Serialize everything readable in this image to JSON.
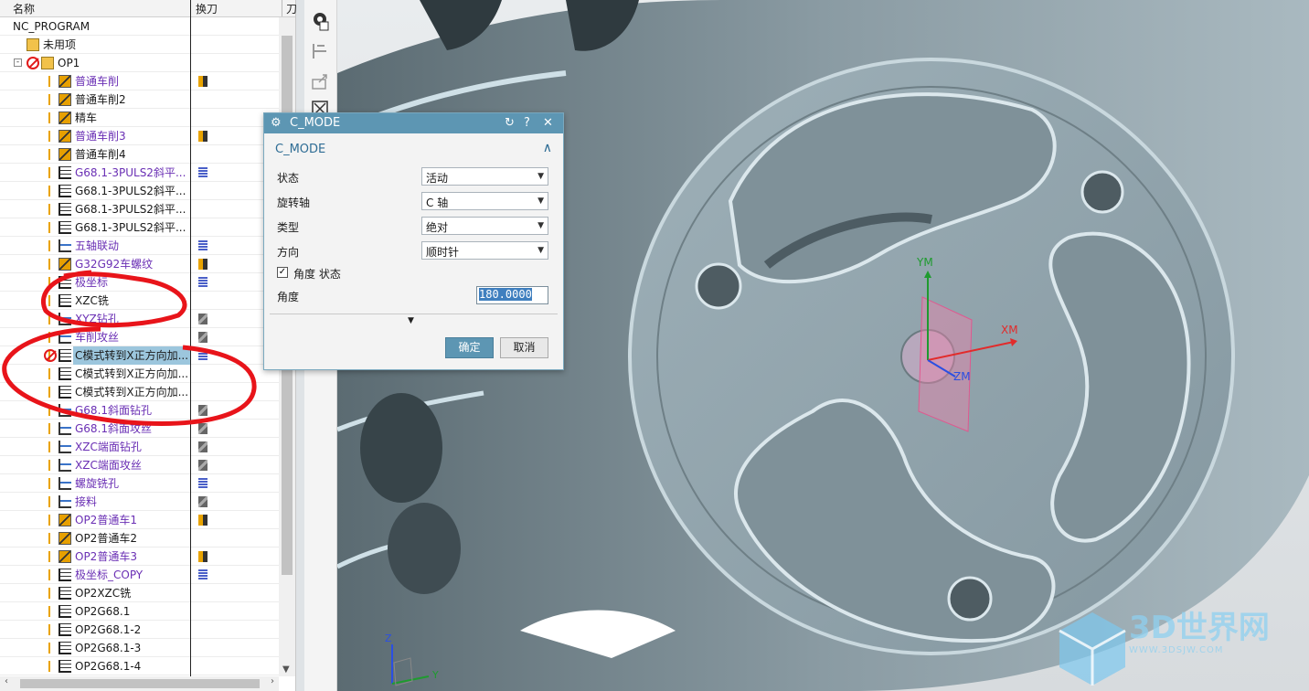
{
  "navigator": {
    "col_name": "名称",
    "col_tool": "换刀",
    "col_more": "刀",
    "rows": [
      {
        "label": "NC_PROGRAM",
        "indent": 14,
        "type": "root"
      },
      {
        "label": "未用项",
        "indent": 47,
        "type": "folder"
      },
      {
        "label": "OP1",
        "indent": 63,
        "type": "folder",
        "prohibited": true,
        "expander": "-"
      },
      {
        "label": "普通车削",
        "indent": 82,
        "type": "turn",
        "purple": true,
        "tool": "y"
      },
      {
        "label": "普通车削2",
        "indent": 82,
        "type": "turn",
        "tool": ""
      },
      {
        "label": "精车",
        "indent": 82,
        "type": "turn",
        "tool": ""
      },
      {
        "label": "普通车削3",
        "indent": 82,
        "type": "turn",
        "purple": true,
        "tool": "y"
      },
      {
        "label": "普通车削4",
        "indent": 82,
        "type": "turn",
        "tool": ""
      },
      {
        "label": "G68.1-3PULS2斜平...",
        "indent": 82,
        "type": "mill",
        "purple": true,
        "tool": "b"
      },
      {
        "label": "G68.1-3PULS2斜平...",
        "indent": 82,
        "type": "mill",
        "tool": ""
      },
      {
        "label": "G68.1-3PULS2斜平...",
        "indent": 82,
        "type": "mill",
        "tool": ""
      },
      {
        "label": "G68.1-3PULS2斜平...",
        "indent": 82,
        "type": "mill",
        "tool": ""
      },
      {
        "label": "五轴联动",
        "indent": 82,
        "type": "op",
        "purple": true,
        "tool": "b"
      },
      {
        "label": "G32G92车螺纹",
        "indent": 82,
        "type": "turn",
        "purple": true,
        "tool": "y"
      },
      {
        "label": "极坐标",
        "indent": 82,
        "type": "mill",
        "purple": true,
        "tool": "b"
      },
      {
        "label": "XZC铣",
        "indent": 82,
        "type": "mill",
        "tool": ""
      },
      {
        "label": "XYZ钻孔",
        "indent": 82,
        "type": "op",
        "purple": true,
        "tool": "g"
      },
      {
        "label": "车削攻丝",
        "indent": 82,
        "type": "op",
        "purple": true,
        "tool": "g"
      },
      {
        "label": "C模式转到X正方向加...",
        "indent": 82,
        "type": "mill",
        "prohibited": true,
        "selected": true,
        "tool": "b"
      },
      {
        "label": "C模式转到X正方向加...",
        "indent": 82,
        "type": "mill",
        "tool": ""
      },
      {
        "label": "C模式转到X正方向加...",
        "indent": 82,
        "type": "mill",
        "tool": ""
      },
      {
        "label": "G68.1斜面钻孔",
        "indent": 82,
        "type": "op",
        "purple": true,
        "tool": "g"
      },
      {
        "label": "G68.1斜面攻丝",
        "indent": 82,
        "type": "op",
        "purple": true,
        "tool": "g"
      },
      {
        "label": "XZC端面钻孔",
        "indent": 82,
        "type": "op",
        "purple": true,
        "tool": "g"
      },
      {
        "label": "XZC端面攻丝",
        "indent": 82,
        "type": "op",
        "purple": true,
        "tool": "g"
      },
      {
        "label": "螺旋铣孔",
        "indent": 82,
        "type": "op",
        "purple": true,
        "tool": "b"
      },
      {
        "label": "接料",
        "indent": 82,
        "type": "op",
        "purple": true,
        "tool": "g"
      },
      {
        "label": "OP2普通车1",
        "indent": 82,
        "type": "turn",
        "purple": true,
        "tool": "y"
      },
      {
        "label": "OP2普通车2",
        "indent": 82,
        "type": "turn",
        "tool": ""
      },
      {
        "label": "OP2普通车3",
        "indent": 82,
        "type": "turn",
        "purple": true,
        "tool": "y"
      },
      {
        "label": "极坐标_COPY",
        "indent": 82,
        "type": "mill",
        "purple": true,
        "tool": "b"
      },
      {
        "label": "OP2XZC铣",
        "indent": 82,
        "type": "mill",
        "tool": ""
      },
      {
        "label": "OP2G68.1",
        "indent": 82,
        "type": "mill",
        "tool": ""
      },
      {
        "label": "OP2G68.1-2",
        "indent": 82,
        "type": "mill",
        "tool": ""
      },
      {
        "label": "OP2G68.1-3",
        "indent": 82,
        "type": "mill",
        "tool": ""
      },
      {
        "label": "OP2G68.1-4",
        "indent": 82,
        "type": "mill",
        "tool": ""
      }
    ]
  },
  "dialog": {
    "title": "C_MODE",
    "group": "C_MODE",
    "fields": [
      {
        "label": "状态",
        "value": "活动"
      },
      {
        "label": "旋转轴",
        "value": "C 轴"
      },
      {
        "label": "类型",
        "value": "绝对"
      },
      {
        "label": "方向",
        "value": "顺时针"
      }
    ],
    "angle_state_label": "角度 状态",
    "angle_state_checked": true,
    "angle_label": "角度",
    "angle_value": "180.0000",
    "ok": "确定",
    "cancel": "取消"
  },
  "viewport": {
    "wcs_x": "XM",
    "wcs_y": "YM",
    "wcs_z": "ZM",
    "triad_z": "Z",
    "triad_y": "Y",
    "watermark_main": "3D世界网",
    "watermark_sub": "WWW.3DSJW.COM"
  },
  "colors": {
    "accent": "#5d96b3",
    "annotation": "#e8141a",
    "purple_text": "#6a2fb4"
  }
}
